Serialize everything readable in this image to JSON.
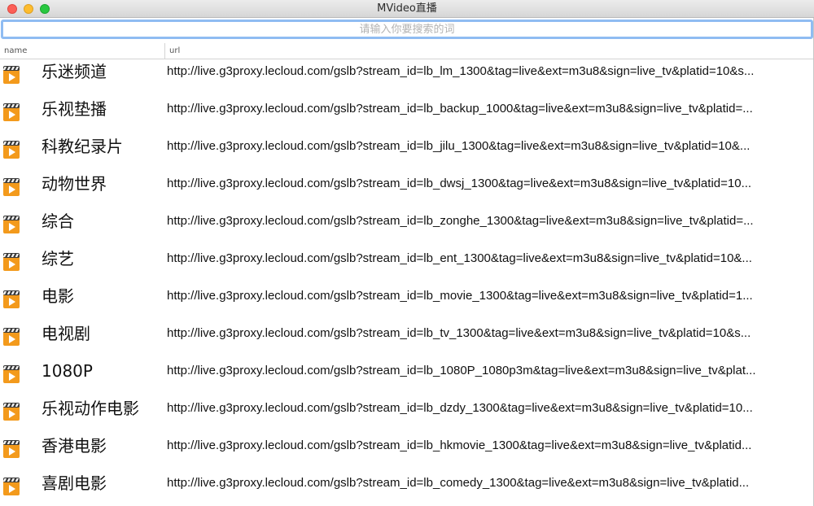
{
  "window": {
    "title": "MVideo直播"
  },
  "search": {
    "placeholder": "请输入你要搜索的词",
    "value": ""
  },
  "table": {
    "columns": [
      "name",
      "url"
    ],
    "rows": [
      {
        "name": "乐迷频道",
        "url": "http://live.g3proxy.lecloud.com/gslb?stream_id=lb_lm_1300&tag=live&ext=m3u8&sign=live_tv&platid=10&s..."
      },
      {
        "name": "乐视垫播",
        "url": "http://live.g3proxy.lecloud.com/gslb?stream_id=lb_backup_1000&tag=live&ext=m3u8&sign=live_tv&platid=..."
      },
      {
        "name": "科教纪录片",
        "url": "http://live.g3proxy.lecloud.com/gslb?stream_id=lb_jilu_1300&tag=live&ext=m3u8&sign=live_tv&platid=10&..."
      },
      {
        "name": "动物世界",
        "url": "http://live.g3proxy.lecloud.com/gslb?stream_id=lb_dwsj_1300&tag=live&ext=m3u8&sign=live_tv&platid=10..."
      },
      {
        "name": "综合",
        "url": "http://live.g3proxy.lecloud.com/gslb?stream_id=lb_zonghe_1300&tag=live&ext=m3u8&sign=live_tv&platid=..."
      },
      {
        "name": "综艺",
        "url": "http://live.g3proxy.lecloud.com/gslb?stream_id=lb_ent_1300&tag=live&ext=m3u8&sign=live_tv&platid=10&..."
      },
      {
        "name": "电影",
        "url": "http://live.g3proxy.lecloud.com/gslb?stream_id=lb_movie_1300&tag=live&ext=m3u8&sign=live_tv&platid=1..."
      },
      {
        "name": "电视剧",
        "url": "http://live.g3proxy.lecloud.com/gslb?stream_id=lb_tv_1300&tag=live&ext=m3u8&sign=live_tv&platid=10&s..."
      },
      {
        "name": "1080P",
        "url": "http://live.g3proxy.lecloud.com/gslb?stream_id=lb_1080P_1080p3m&tag=live&ext=m3u8&sign=live_tv&plat..."
      },
      {
        "name": "乐视动作电影",
        "url": "http://live.g3proxy.lecloud.com/gslb?stream_id=lb_dzdy_1300&tag=live&ext=m3u8&sign=live_tv&platid=10..."
      },
      {
        "name": "香港电影",
        "url": "http://live.g3proxy.lecloud.com/gslb?stream_id=lb_hkmovie_1300&tag=live&ext=m3u8&sign=live_tv&platid..."
      },
      {
        "name": "喜剧电影",
        "url": "http://live.g3proxy.lecloud.com/gslb?stream_id=lb_comedy_1300&tag=live&ext=m3u8&sign=live_tv&platid..."
      }
    ]
  },
  "icons": {
    "row_icon": "video-play-icon",
    "accent": "#f39a1c"
  }
}
